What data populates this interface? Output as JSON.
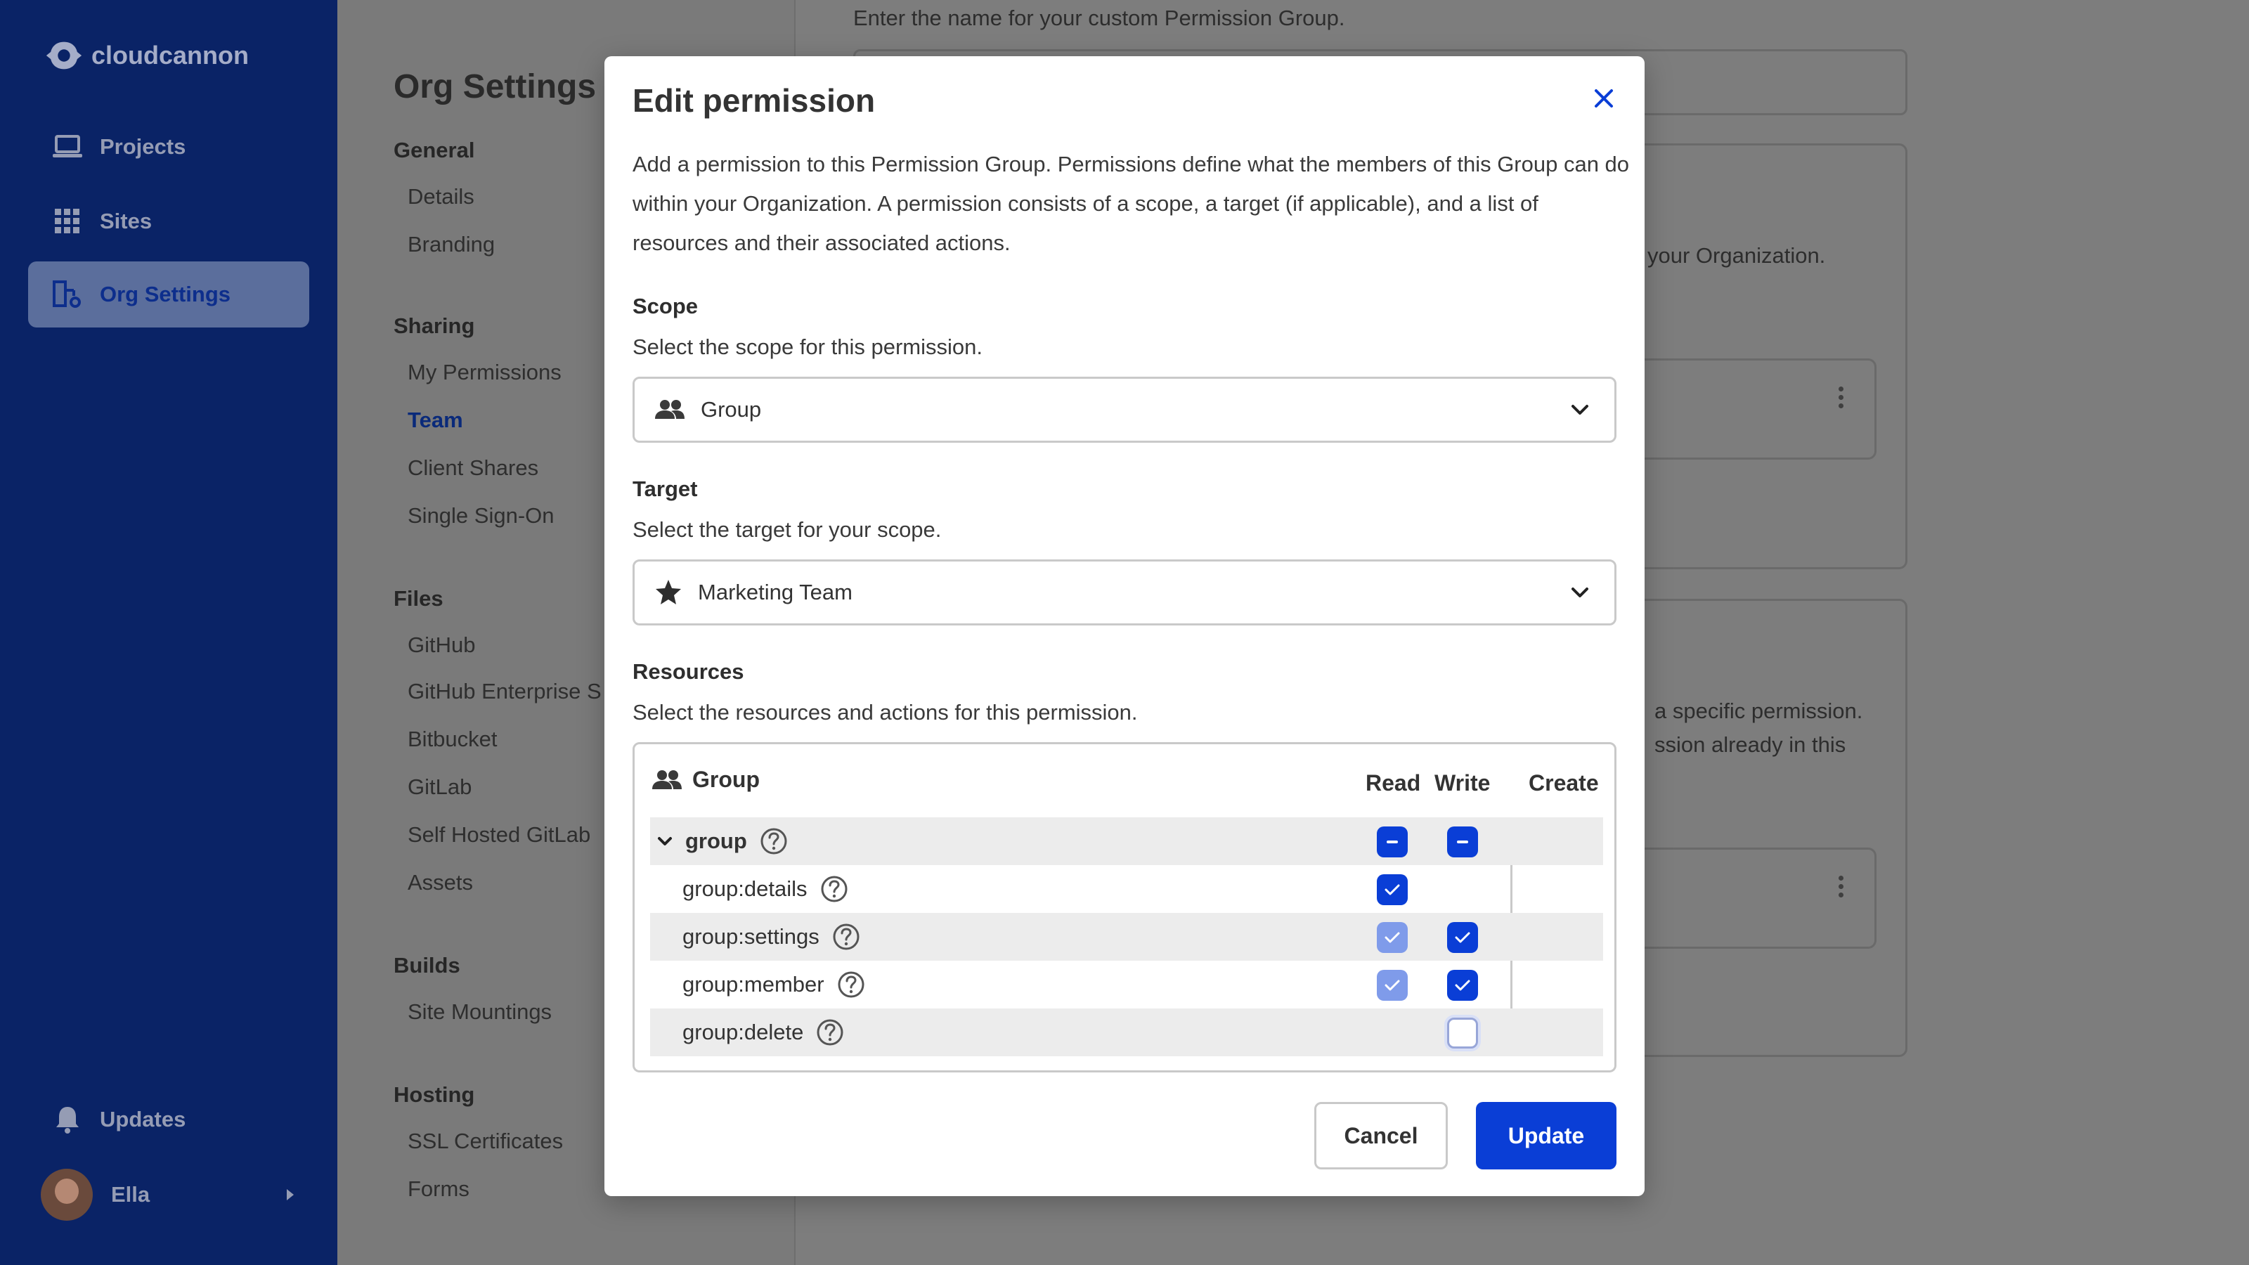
{
  "app": {
    "logo_text": "cloudcannon",
    "nav": [
      {
        "label": "Projects",
        "icon": "laptop-icon"
      },
      {
        "label": "Sites",
        "icon": "grid-icon"
      },
      {
        "label": "Org Settings",
        "icon": "org-settings-icon",
        "active": true
      }
    ],
    "updates_label": "Updates",
    "user_name": "Ella"
  },
  "settings": {
    "title": "Org Settings",
    "sections": [
      {
        "heading": "General",
        "items": [
          "Details",
          "Branding"
        ]
      },
      {
        "heading": "Sharing",
        "items": [
          "My Permissions",
          "Team",
          "Client Shares",
          "Single Sign-On"
        ],
        "active": "Team"
      },
      {
        "heading": "Files",
        "items": [
          "GitHub",
          "GitHub Enterprise S",
          "Bitbucket",
          "GitLab",
          "Self Hosted GitLab",
          "Assets"
        ]
      },
      {
        "heading": "Builds",
        "items": [
          "Site Mountings"
        ]
      },
      {
        "heading": "Hosting",
        "items": [
          "SSL Certificates",
          "Forms"
        ]
      }
    ]
  },
  "background": {
    "hint": "Enter the name for your custom Permission Group.",
    "snippet_1": "your Organization.",
    "snippet_2": "a specific permission.",
    "snippet_3": "ssion already in this"
  },
  "modal": {
    "title": "Edit permission",
    "description": "Add a permission to this Permission Group. Permissions define what the members of this Group can do within your Organization. A permission consists of a scope, a target (if applicable), and a list of resources and their associated actions.",
    "scope": {
      "label": "Scope",
      "help": "Select the scope for this permission.",
      "value": "Group"
    },
    "target": {
      "label": "Target",
      "help": "Select the target for your scope.",
      "value": "Marketing Team"
    },
    "resources": {
      "label": "Resources",
      "help": "Select the resources and actions for this permission.",
      "group_label": "Group",
      "columns": [
        "Read",
        "Write",
        "Create"
      ],
      "rows": [
        {
          "name": "group",
          "read": "indeterminate",
          "write": "indeterminate"
        },
        {
          "name": "group:details",
          "read": "checked",
          "write": "none"
        },
        {
          "name": "group:settings",
          "read": "implied",
          "write": "checked"
        },
        {
          "name": "group:member",
          "read": "implied",
          "write": "checked"
        },
        {
          "name": "group:delete",
          "read": "none",
          "write": "unchecked"
        }
      ]
    },
    "cancel_label": "Cancel",
    "update_label": "Update"
  },
  "colors": {
    "sidebar": "#0a2366",
    "accent": "#0a3ed6",
    "implied": "#7f9bea"
  }
}
